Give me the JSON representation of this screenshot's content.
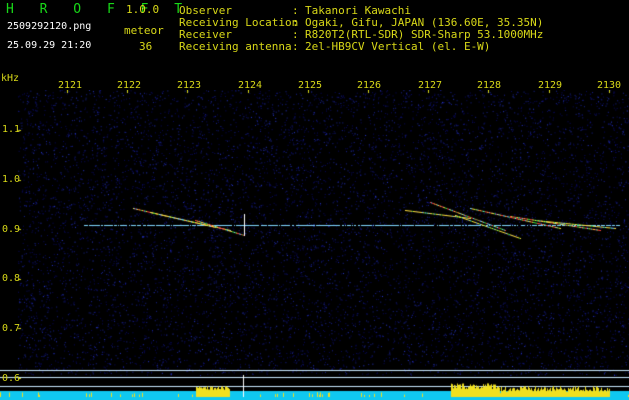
{
  "header": {
    "app_title": "H R O F F T",
    "version": "1.0.0",
    "filename": "2509292120.png",
    "datetime": "25.09.29 21:20",
    "meteor_label": "meteor",
    "meteor_count": "36"
  },
  "info": [
    {
      "key": "Observer",
      "value": "Takanori Kawachi"
    },
    {
      "key": "Receiving Location",
      "value": "Ogaki, Gifu, JAPAN (136.60E, 35.35N)"
    },
    {
      "key": "Receiver",
      "value": "R820T2(RTL-SDR) SDR-Sharp 53.1000MHz"
    },
    {
      "key": "Receiving antenna",
      "value": "2el-HB9CV Vertical (el. E-W)"
    }
  ],
  "info_separator": ":",
  "axes": {
    "y_unit": "kHz",
    "time_ticks": [
      "2121",
      "2122",
      "2123",
      "2124",
      "2125",
      "2126",
      "2127",
      "2128",
      "2129",
      "2130"
    ],
    "freq_ticks": [
      "1.1",
      "1.0",
      "0.9",
      "0.8",
      "0.7",
      "0.6"
    ]
  },
  "colors": {
    "header_yellow": "#d8d818",
    "title_green": "#18d818",
    "noise_dark": "#0a0a60",
    "noise_blue": "#2a3ad8",
    "carrier": "#80d8ff",
    "echo_hot": "#ff4040",
    "echo_warm": "#ffe040",
    "level_cyan": "#10c8f0",
    "level_peak": "#f0e020"
  }
}
